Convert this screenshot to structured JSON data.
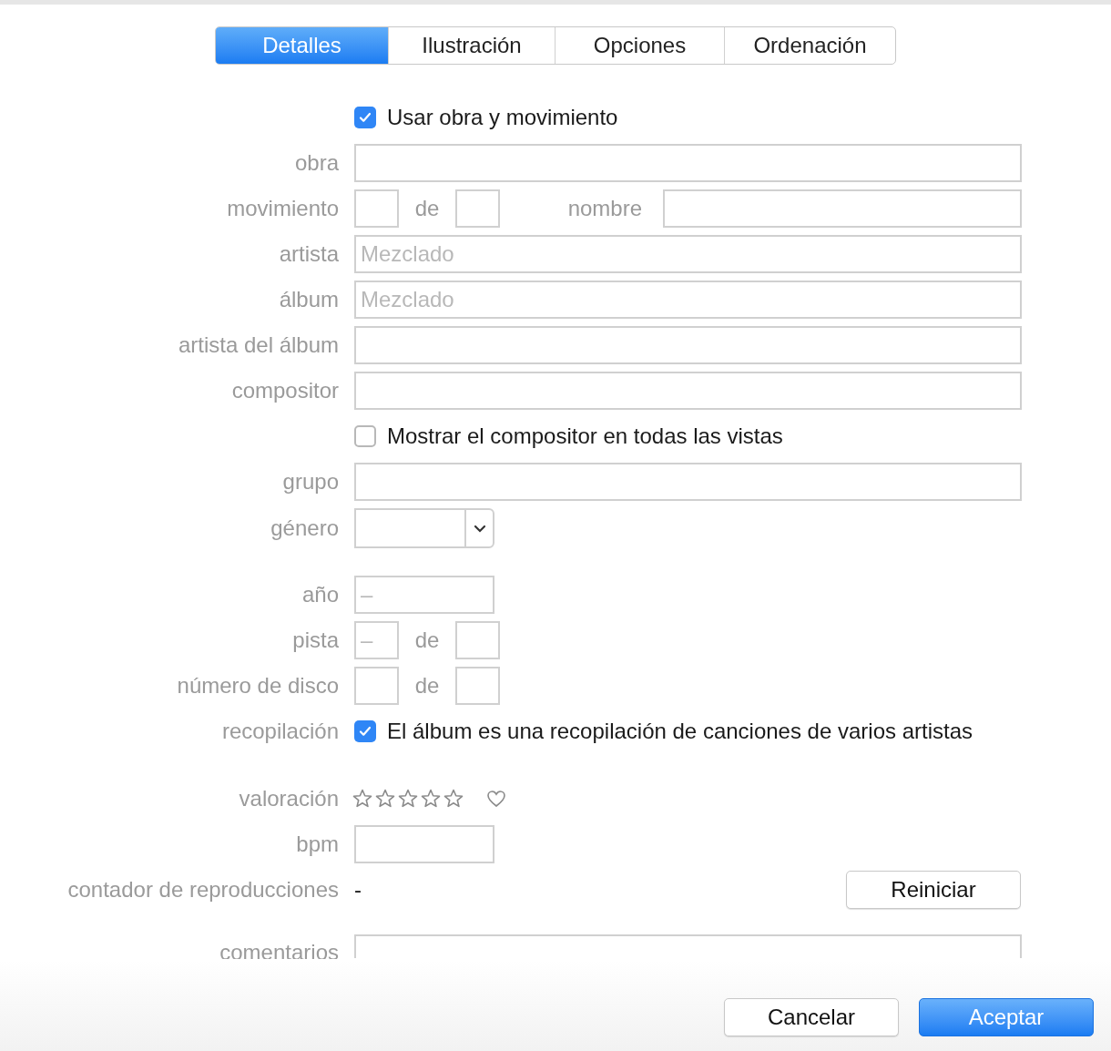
{
  "tabs": [
    {
      "label": "Detalles",
      "selected": true
    },
    {
      "label": "Ilustración",
      "selected": false
    },
    {
      "label": "Opciones",
      "selected": false
    },
    {
      "label": "Ordenación",
      "selected": false
    }
  ],
  "rows": [
    {
      "kind": "checkbox",
      "text": "Usar obra y movimiento",
      "checked": true
    },
    {
      "kind": "text",
      "label": "obra"
    },
    {
      "kind": "movement",
      "label": "movimiento",
      "of": "de",
      "name_label": "nombre"
    },
    {
      "kind": "text",
      "label": "artista",
      "placeholder": "Mezclado"
    },
    {
      "kind": "text",
      "label": "álbum",
      "placeholder": "Mezclado"
    },
    {
      "kind": "text",
      "label": "artista del álbum"
    },
    {
      "kind": "text",
      "label": "compositor"
    },
    {
      "kind": "checkbox",
      "text": "Mostrar el compositor en todas las vistas",
      "checked": false
    },
    {
      "kind": "text",
      "label": "grupo"
    },
    {
      "kind": "select",
      "label": "género"
    },
    {
      "kind": "short",
      "label": "año",
      "placeholder": "–"
    },
    {
      "kind": "pair",
      "label": "pista",
      "placeholder": "–",
      "of": "de"
    },
    {
      "kind": "pair",
      "label": "número de disco",
      "of": "de"
    },
    {
      "kind": "checkbox",
      "label": "recopilación",
      "text": "El álbum es una recopilación de canciones de varios artistas",
      "checked": true
    },
    {
      "kind": "rating",
      "label": "valoración",
      "stars": 0
    },
    {
      "kind": "short",
      "label": "bpm"
    },
    {
      "kind": "counter",
      "label": "contador de reproducciones",
      "count": "-",
      "button": "Reiniciar"
    },
    {
      "kind": "textarea",
      "label": "comentarios"
    }
  ],
  "buttons": [
    {
      "label": "Cancelar",
      "primary": false
    },
    {
      "label": "Aceptar",
      "primary": true
    }
  ]
}
